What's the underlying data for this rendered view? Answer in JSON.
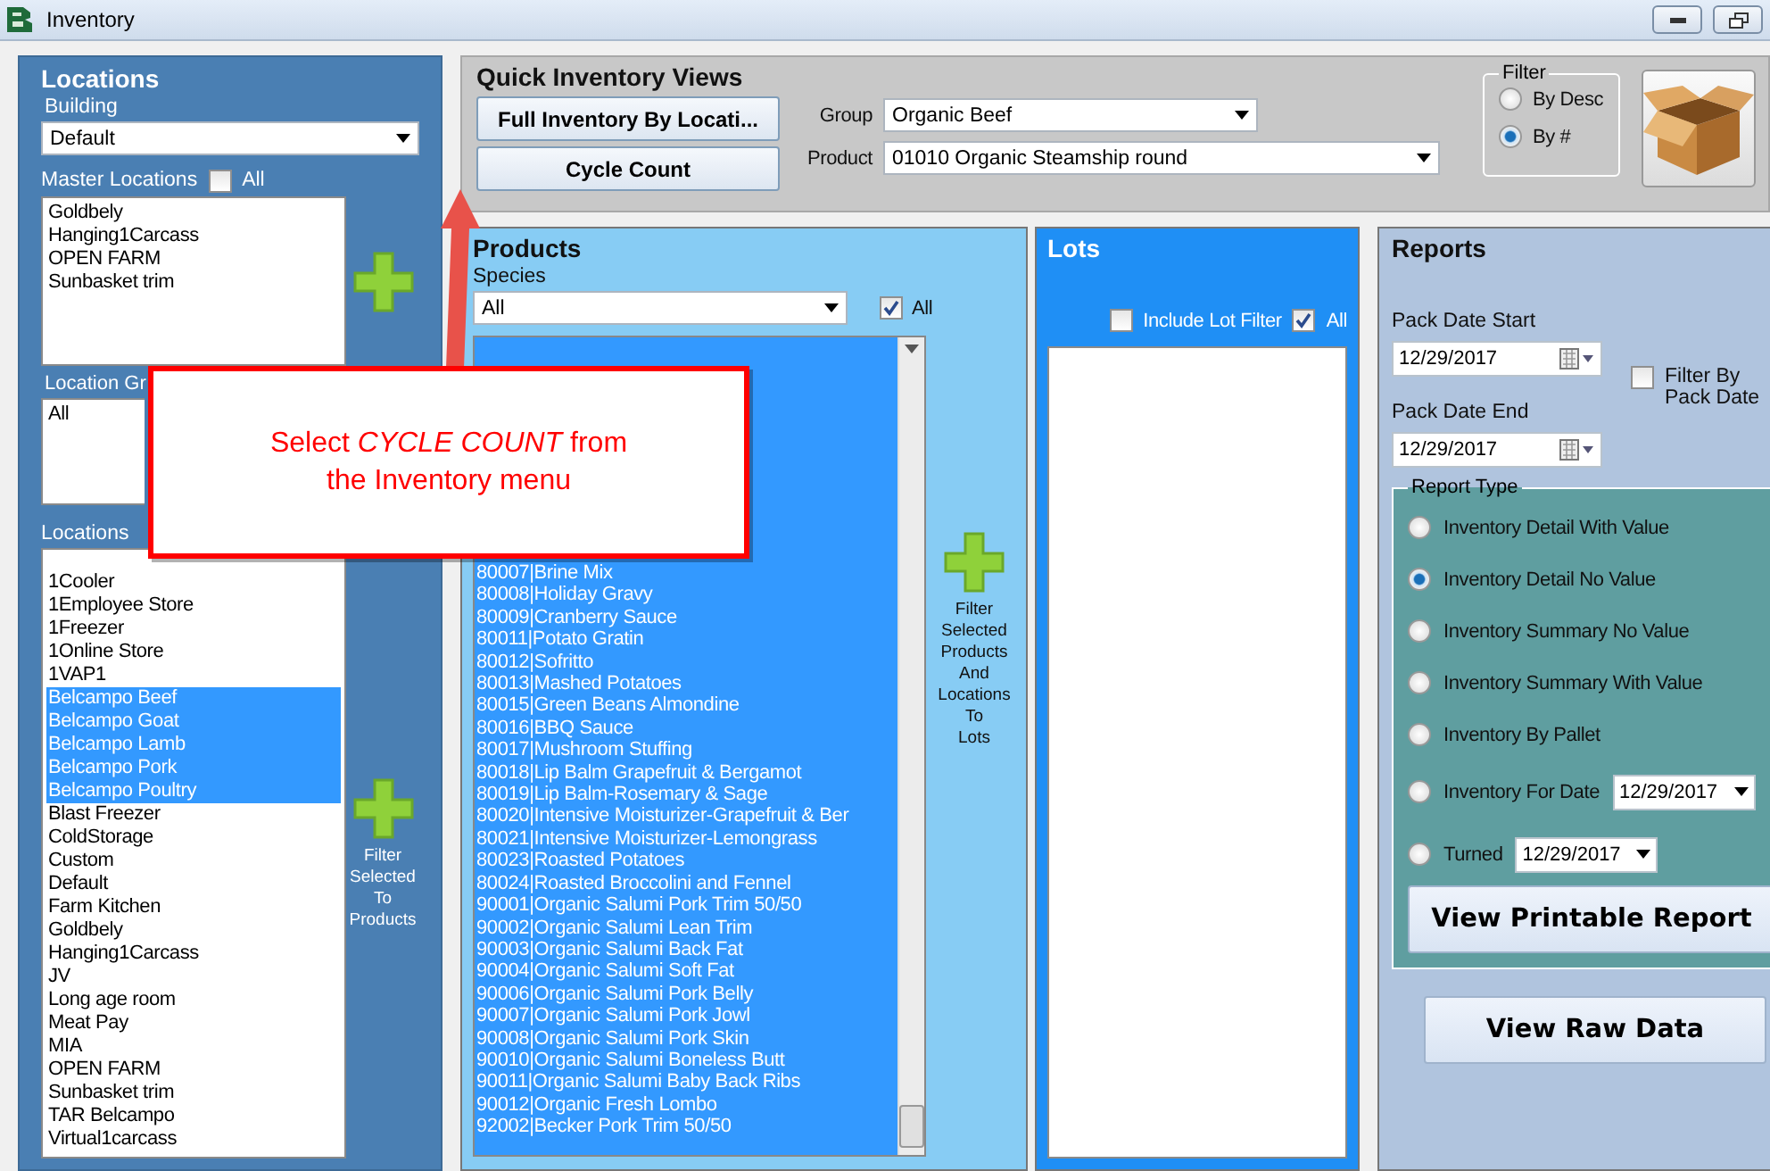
{
  "window": {
    "title": "Inventory"
  },
  "locations": {
    "title": "Locations",
    "building_label": "Building",
    "building_value": "Default",
    "master_label": "Master Locations",
    "master_all": {
      "label": "All",
      "checked": false
    },
    "master_items": [
      "Goldbely",
      "Hanging1Carcass",
      "OPEN FARM",
      "Sunbasket trim"
    ],
    "group_label": "Location Gr",
    "group_items": [
      "All"
    ],
    "locations_label": "Locations",
    "locations_items": [
      {
        "label": "1Cooler",
        "selected": false
      },
      {
        "label": "1Employee Store",
        "selected": false
      },
      {
        "label": "1Freezer",
        "selected": false
      },
      {
        "label": "1Online Store",
        "selected": false
      },
      {
        "label": "1VAP1",
        "selected": false
      },
      {
        "label": "Belcampo Beef",
        "selected": true
      },
      {
        "label": "Belcampo Goat",
        "selected": true
      },
      {
        "label": "Belcampo Lamb",
        "selected": true
      },
      {
        "label": "Belcampo Pork",
        "selected": true
      },
      {
        "label": "Belcampo Poultry",
        "selected": true
      },
      {
        "label": "Blast Freezer",
        "selected": false
      },
      {
        "label": "ColdStorage",
        "selected": false
      },
      {
        "label": "Custom",
        "selected": false
      },
      {
        "label": "Default",
        "selected": false
      },
      {
        "label": "Farm Kitchen",
        "selected": false
      },
      {
        "label": "Goldbely",
        "selected": false
      },
      {
        "label": "Hanging1Carcass",
        "selected": false
      },
      {
        "label": "JV",
        "selected": false
      },
      {
        "label": "Long age room",
        "selected": false
      },
      {
        "label": "Meat Pay",
        "selected": false
      },
      {
        "label": "MIA",
        "selected": false
      },
      {
        "label": "OPEN FARM",
        "selected": false
      },
      {
        "label": "Sunbasket trim",
        "selected": false
      },
      {
        "label": "TAR Belcampo",
        "selected": false
      },
      {
        "label": "Virtual1carcass",
        "selected": false
      }
    ],
    "filter_button": "Filter\nSelected\nTo\nProducts"
  },
  "quick_views": {
    "title": "Quick Inventory Views",
    "buttons": [
      "Full Inventory By Locati...",
      "Cycle Count"
    ],
    "group_label": "Group",
    "group_value": "Organic Beef",
    "product_label": "Product",
    "product_value": "01010 Organic Steamship round",
    "filter": {
      "title": "Filter",
      "options": [
        {
          "label": "By Desc",
          "selected": false
        },
        {
          "label": "By #",
          "selected": true
        }
      ]
    }
  },
  "products": {
    "title": "Products",
    "species_label": "Species",
    "species_value": "All",
    "all": {
      "label": "All",
      "checked": true
    },
    "items": [
      {
        "label": "80007|Brine Mix",
        "selected": true
      },
      {
        "label": "80008|Holiday Gravy",
        "selected": true
      },
      {
        "label": "80009|Cranberry Sauce",
        "selected": true
      },
      {
        "label": "80011|Potato Gratin",
        "selected": true
      },
      {
        "label": "80012|Sofritto",
        "selected": true
      },
      {
        "label": "80013|Mashed Potatoes",
        "selected": true
      },
      {
        "label": "80015|Green Beans Almondine",
        "selected": true
      },
      {
        "label": "80016|BBQ Sauce",
        "selected": true
      },
      {
        "label": "80017|Mushroom Stuffing",
        "selected": true
      },
      {
        "label": "80018|Lip Balm Grapefruit & Bergamot",
        "selected": true
      },
      {
        "label": "80019|Lip Balm-Rosemary & Sage",
        "selected": true
      },
      {
        "label": "80020|Intensive Moisturizer-Grapefruit & Ber",
        "selected": true
      },
      {
        "label": "80021|Intensive Moisturizer-Lemongrass",
        "selected": true
      },
      {
        "label": "80023|Roasted Potatoes",
        "selected": true
      },
      {
        "label": "80024|Roasted Broccolini and Fennel",
        "selected": true
      },
      {
        "label": "90001|Organic Salumi  Pork Trim 50/50",
        "selected": true
      },
      {
        "label": "90002|Organic Salumi Lean Trim",
        "selected": true
      },
      {
        "label": "90003|Organic Salumi Back Fat",
        "selected": true
      },
      {
        "label": "90004|Organic Salumi Soft Fat",
        "selected": true
      },
      {
        "label": "90006|Organic Salumi Pork Belly",
        "selected": true
      },
      {
        "label": "90007|Organic Salumi Pork Jowl",
        "selected": true
      },
      {
        "label": "90008|Organic Salumi Pork Skin",
        "selected": true
      },
      {
        "label": "90010|Organic Salumi Boneless Butt",
        "selected": true
      },
      {
        "label": "90011|Organic Salumi Baby Back Ribs",
        "selected": true
      },
      {
        "label": "90012|Organic Fresh Lombo",
        "selected": true
      },
      {
        "label": "92002|Becker Pork Trim 50/50",
        "selected": true
      }
    ],
    "filter_button": "Filter\nSelected\nProducts\nAnd\nLocations\nTo\nLots"
  },
  "lots": {
    "title": "Lots",
    "include": {
      "label": "Include Lot Filter",
      "checked": false
    },
    "all": {
      "label": "All",
      "checked": true
    }
  },
  "reports": {
    "title": "Reports",
    "start_label": "Pack Date Start",
    "start_value": "12/29/2017",
    "end_label": "Pack Date End",
    "end_value": "12/29/2017",
    "filter_by_pack": {
      "label": "Filter By\nPack Date",
      "checked": false
    },
    "report_type": {
      "title": "Report Type",
      "options": [
        {
          "label": "Inventory Detail With Value",
          "selected": false
        },
        {
          "label": "Inventory Detail No Value",
          "selected": true
        },
        {
          "label": "Inventory Summary  No Value",
          "selected": false
        },
        {
          "label": "Inventory Summary With Value",
          "selected": false
        },
        {
          "label": "Inventory By Pallet",
          "selected": false
        },
        {
          "label": "Inventory For Date",
          "selected": false,
          "date": "12/29/2017"
        },
        {
          "label": "Turned",
          "selected": false,
          "date": "12/29/2017"
        }
      ]
    },
    "print_button": "View Printable Report",
    "raw_button": "View Raw Data"
  },
  "callout": {
    "text": "Select *CYCLE COUNT* from the Inventory menu"
  }
}
